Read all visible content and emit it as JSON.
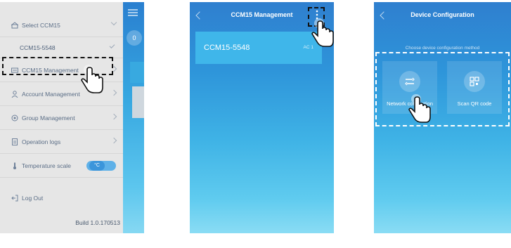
{
  "screen1": {
    "drawer": {
      "select_label": "Select CCM15",
      "selected_device": "CCM15-5548",
      "items": [
        {
          "label": "CCM15 Management",
          "icon": "device-icon"
        },
        {
          "label": "Account Management",
          "icon": "person-icon"
        },
        {
          "label": "Group Management",
          "icon": "group-icon"
        },
        {
          "label": "Operation logs",
          "icon": "log-icon"
        },
        {
          "label": "Temperature scale",
          "icon": "thermometer-icon"
        }
      ],
      "temp_unit": "°C",
      "logout_label": "Log Out",
      "build": "Build 1.0.170513"
    },
    "peek_badge": "0"
  },
  "screen2": {
    "title": "CCM15 Management",
    "device": {
      "name": "CCM15-5548",
      "meta": "AC 1"
    }
  },
  "screen3": {
    "title": "Device Configuration",
    "subtitle": "Choose device configuration method",
    "options": [
      {
        "label": "Network connection",
        "icon": "network-icon"
      },
      {
        "label": "Scan QR code",
        "icon": "qr-code-icon"
      }
    ]
  }
}
